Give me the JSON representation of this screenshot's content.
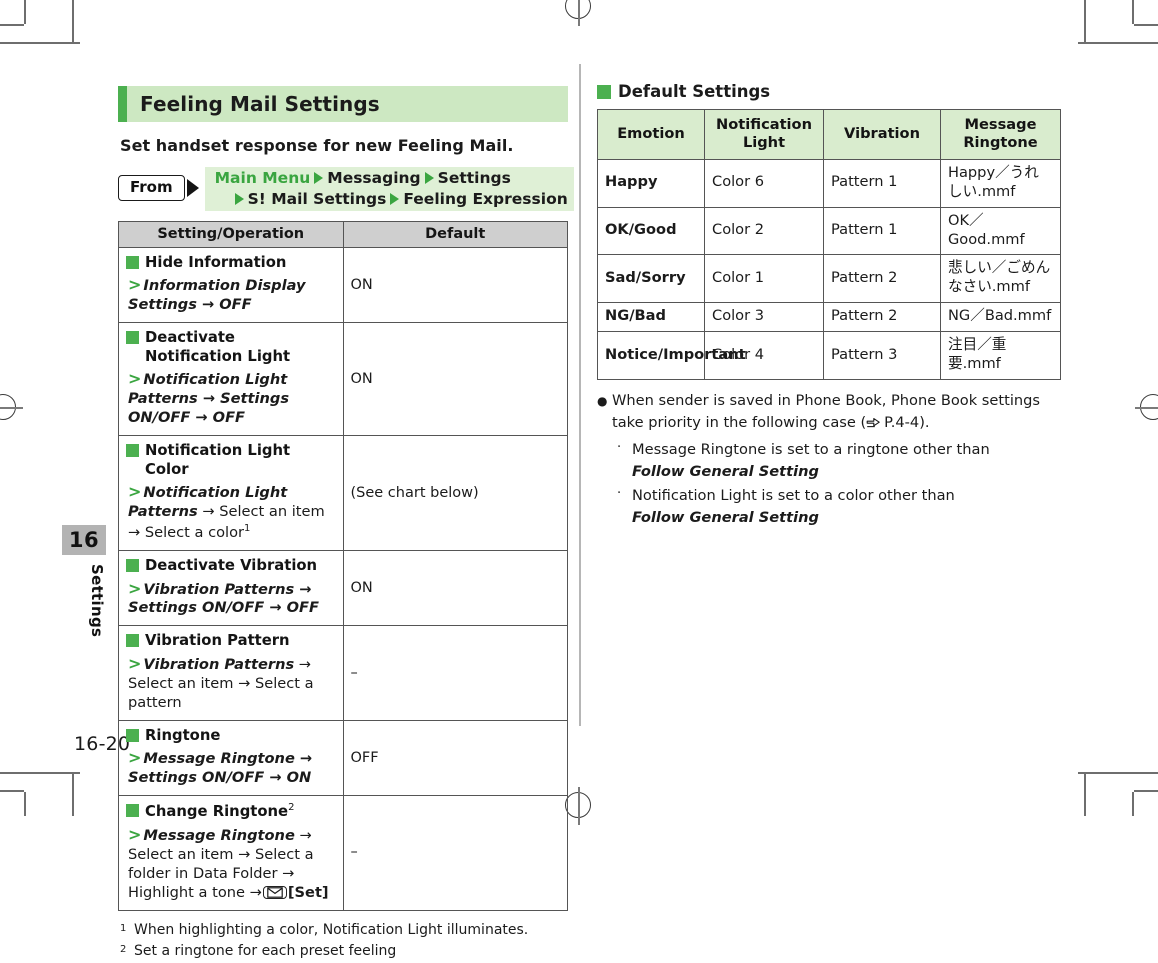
{
  "document": {
    "page_number": "16-20",
    "chapter_number": "16",
    "chapter_name": "Settings"
  },
  "left_column": {
    "section_title": "Feeling Mail Settings",
    "lead_text": "Set handset response for new Feeling Mail.",
    "from_label": "From",
    "path_line_1_a": "Main Menu",
    "path_line_1_b": "Messaging",
    "path_line_1_c": "Settings",
    "path_line_2_a": "S! Mail Settings",
    "path_line_2_b": "Feeling Expression",
    "table": {
      "headers": [
        "Setting/Operation",
        "Default"
      ],
      "rows": [
        {
          "title": "Hide Information",
          "path": "Information Display Settings → OFF",
          "default": "ON"
        },
        {
          "title": "Deactivate Notification Light",
          "path": "Notification Light Patterns → Settings ON/OFF → OFF",
          "default": "ON"
        },
        {
          "title": "Notification Light Color",
          "path": "Notification Light Patterns → Select an item → Select a color",
          "path_sup": "1",
          "default": "(See chart below)"
        },
        {
          "title": "Deactivate Vibration",
          "path": "Vibration Patterns → Settings ON/OFF → OFF",
          "default": "ON"
        },
        {
          "title": "Vibration Pattern",
          "path": "Vibration Patterns → Select an item → Select a pattern",
          "default": "–"
        },
        {
          "title": "Ringtone",
          "path": "Message Ringtone → Settings ON/OFF → ON",
          "default": "OFF"
        },
        {
          "title": "Change Ringtone",
          "title_sup": "2",
          "path": "Message Ringtone → Select an item → Select a folder in Data Folder → Highlight a tone →",
          "path_key": "[Set]",
          "default": "–"
        }
      ]
    },
    "footnotes": [
      {
        "marker": "1",
        "text": "When highlighting a color, Notification Light illuminates."
      },
      {
        "marker": "2",
        "text": "Set a ringtone for each preset feeling"
      }
    ]
  },
  "right_column": {
    "sub_heading": "Default Settings",
    "table": {
      "headers": [
        "Emotion",
        "Notification Light",
        "Vibration",
        "Message Ringtone"
      ],
      "rows": [
        {
          "emotion": "Happy",
          "light": "Color 6",
          "vibration": "Pattern 1",
          "ringtone": "Happy／うれしい.mmf"
        },
        {
          "emotion": "OK/Good",
          "light": "Color 2",
          "vibration": "Pattern 1",
          "ringtone": "OK／Good.mmf"
        },
        {
          "emotion": "Sad/Sorry",
          "light": "Color 1",
          "vibration": "Pattern 2",
          "ringtone": "悲しい／ごめんなさい.mmf"
        },
        {
          "emotion": "NG/Bad",
          "light": "Color 3",
          "vibration": "Pattern 2",
          "ringtone": "NG／Bad.mmf"
        },
        {
          "emotion": "Notice/Important",
          "light": "Color 4",
          "vibration": "Pattern 3",
          "ringtone": "注目／重要.mmf"
        }
      ]
    },
    "note": {
      "main_a": "When sender is saved in Phone Book, Phone Book settings take priority in the following case (",
      "main_ref": "P.4-4",
      "main_b": ").",
      "items": [
        {
          "text": "Message Ringtone is set to a ringtone other than",
          "emphasis": "Follow General Setting"
        },
        {
          "text": "Notification Light is set to a color other than",
          "emphasis": "Follow General Setting"
        }
      ]
    }
  },
  "colors": {
    "accent_green": "#4cb050",
    "title_band": "#cde8c2",
    "path_band": "#dff0d6",
    "table_header_gray": "#cfcfcf",
    "table_header_green": "#d9ecce",
    "tab_gray": "#b3b3b3"
  }
}
